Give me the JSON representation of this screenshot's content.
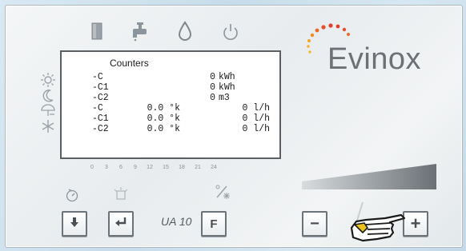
{
  "brand": {
    "name": "Evinox"
  },
  "model": {
    "name": "UA 10"
  },
  "top_icons": [
    "cylinder-icon",
    "tap-icon",
    "water-drop-icon",
    "power-icon"
  ],
  "side_icons": [
    "sun-icon",
    "moon-icon",
    "holiday-umbrella-icon",
    "frost-snowflake-icon"
  ],
  "screen": {
    "title": "Counters",
    "energy_rows": [
      {
        "label": "-C",
        "value": "0",
        "unit": "kWh"
      },
      {
        "label": "-C1",
        "value": "0",
        "unit": "kWh"
      },
      {
        "label": "-C2",
        "value": "0",
        "unit": "m3"
      }
    ],
    "temp_rows": [
      {
        "label": "-C",
        "temp": "0.0 °k",
        "flow": "0 l/h"
      },
      {
        "label": "-C1",
        "temp": "0.0 °k",
        "flow": "0 l/h"
      },
      {
        "label": "-C2",
        "temp": "0.0 °k",
        "flow": "0 l/h"
      }
    ]
  },
  "time_scale": [
    "0",
    "3",
    "6",
    "9",
    "12",
    "15",
    "18",
    "21",
    "24"
  ],
  "buttons": {
    "down": {
      "icon": "down-arrow-icon"
    },
    "enter": {
      "icon": "enter-arrow-icon"
    },
    "function": {
      "label": "F"
    },
    "minus": {
      "label": "−"
    },
    "plus": {
      "label": "+"
    }
  },
  "colors": {
    "panel": "#eef1f2",
    "brand_dots_a": "#e0402a",
    "brand_dots_b": "#f4b522"
  }
}
